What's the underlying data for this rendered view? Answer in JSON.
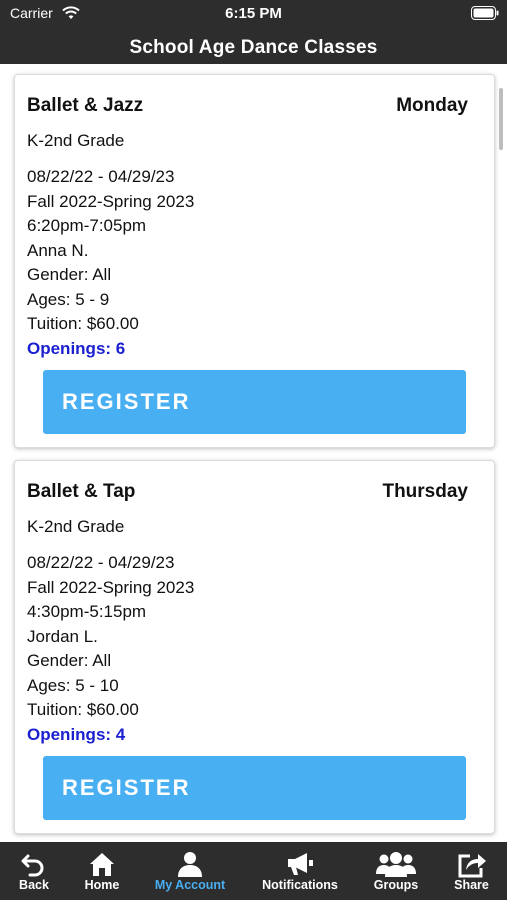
{
  "status_bar": {
    "carrier": "Carrier",
    "time": "6:15 PM"
  },
  "header": {
    "title": "School Age Dance Classes"
  },
  "classes": [
    {
      "name": "Ballet & Jazz",
      "day": "Monday",
      "grade": "K-2nd Grade",
      "dates": "08/22/22 - 04/29/23",
      "session": "Fall 2022-Spring 2023",
      "time": "6:20pm-7:05pm",
      "instructor": "Anna N.",
      "gender": "Gender: All",
      "ages": "Ages: 5 - 9",
      "tuition": "Tuition: $60.00",
      "openings": "Openings: 6",
      "register_label": "REGISTER"
    },
    {
      "name": "Ballet & Tap",
      "day": "Thursday",
      "grade": "K-2nd Grade",
      "dates": "08/22/22 - 04/29/23",
      "session": "Fall 2022-Spring 2023",
      "time": "4:30pm-5:15pm",
      "instructor": "Jordan L.",
      "gender": "Gender: All",
      "ages": "Ages: 5 - 10",
      "tuition": "Tuition: $60.00",
      "openings": "Openings: 4",
      "register_label": "REGISTER"
    }
  ],
  "tabs": [
    {
      "label": "Back",
      "icon": "back-arrow-icon"
    },
    {
      "label": "Home",
      "icon": "home-icon"
    },
    {
      "label": "My Account",
      "icon": "user-icon",
      "active": true
    },
    {
      "label": "Notifications",
      "icon": "megaphone-icon"
    },
    {
      "label": "Groups",
      "icon": "group-icon"
    },
    {
      "label": "Share",
      "icon": "share-icon"
    }
  ],
  "colors": {
    "bar_bg": "#2d2d2d",
    "register_button": "#48aff2",
    "openings_text": "#1a1fd0",
    "active_tab": "#48aff2"
  }
}
